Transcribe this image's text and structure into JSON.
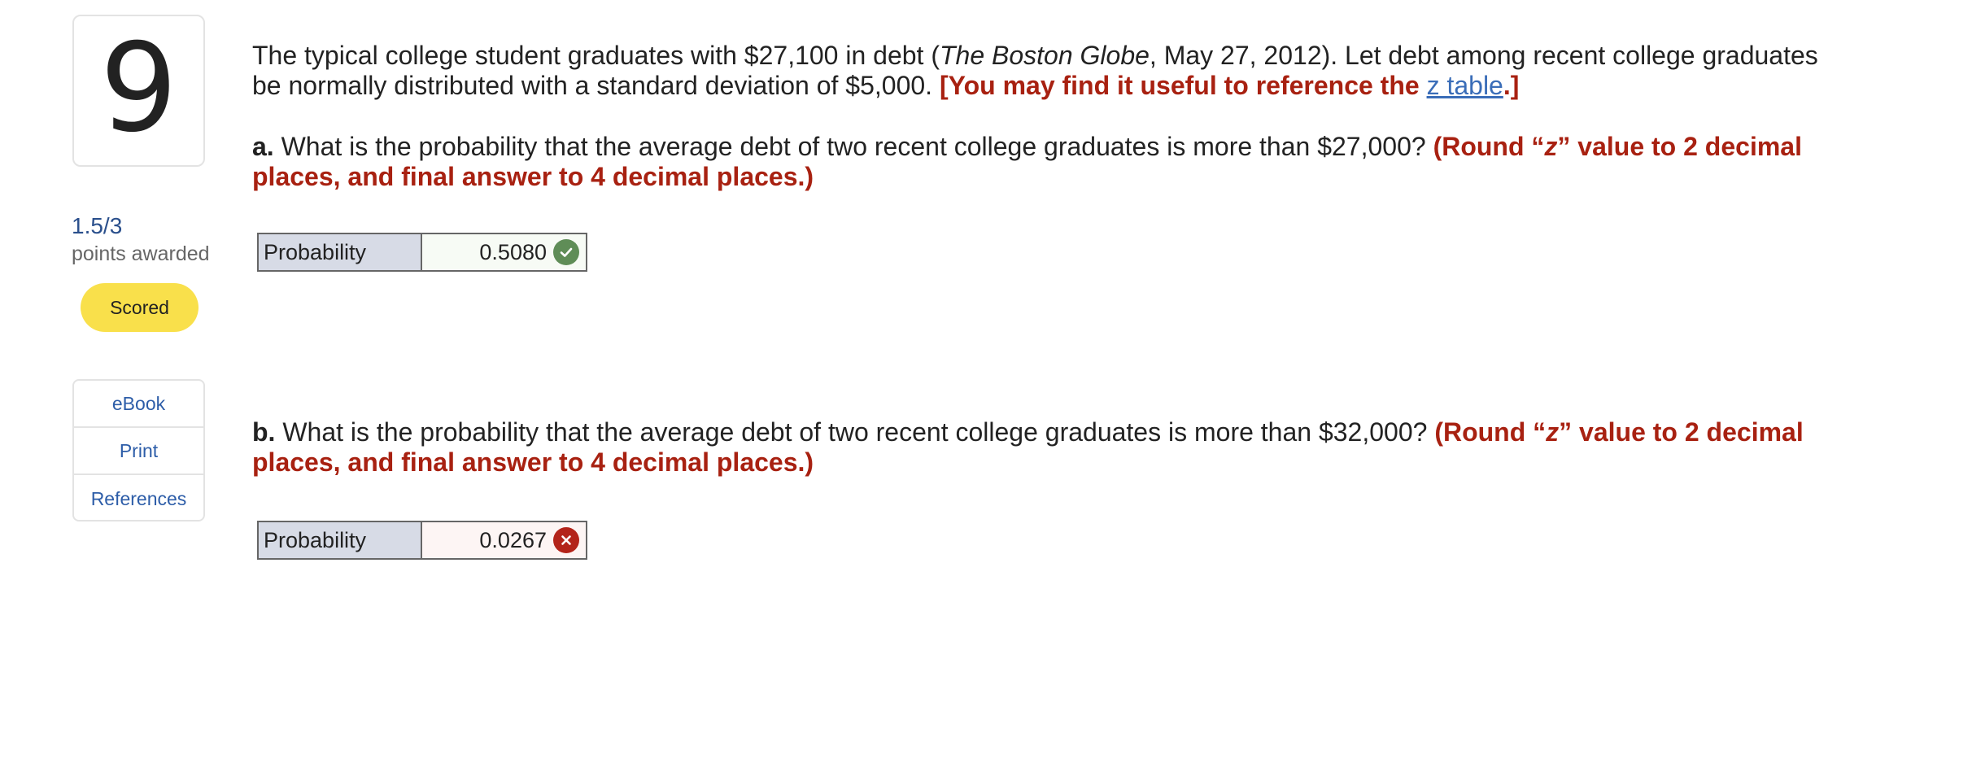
{
  "question": {
    "number": "9",
    "score": "1.5/3",
    "score_label": "points awarded",
    "status_badge": "Scored"
  },
  "resources": {
    "items": [
      {
        "label": "eBook"
      },
      {
        "label": "Print"
      },
      {
        "label": "References"
      }
    ]
  },
  "intro": {
    "text_1": "The typical college student graduates with $27,100 in debt (",
    "source_italic": "The Boston Globe",
    "text_2": ", May 27, 2012). Let debt among recent college graduates be normally distributed with a standard deviation of $5,000. ",
    "hint_open": "[You may find it useful to reference the ",
    "hint_link": "z table",
    "hint_close": ".]"
  },
  "parts": [
    {
      "letter": "a.",
      "question": " What is the probability that the average debt of two recent college graduates is more than $27,000? ",
      "instruction_1": "(Round “",
      "instruction_z": "z",
      "instruction_2": "” value to 2 decimal places, and final answer to 4 decimal places.)",
      "answer_label": "Probability",
      "answer_value": "0.5080",
      "answer_status": "correct",
      "status_icon": "check-icon"
    },
    {
      "letter": "b.",
      "question": " What is the probability that the average debt of two recent college graduates is more than $32,000? ",
      "instruction_1": "(Round “",
      "instruction_z": "z",
      "instruction_2": "” value to 2 decimal places, and final answer to 4 decimal places.)",
      "answer_label": "Probability",
      "answer_value": "0.0267",
      "answer_status": "incorrect",
      "status_icon": "cross-icon"
    }
  ],
  "colors": {
    "instruction_red": "#a82111",
    "link_blue": "#3a6db8",
    "badge_yellow": "#f9e04b",
    "correct_green": "#5f8d57",
    "incorrect_red": "#b3241a"
  }
}
